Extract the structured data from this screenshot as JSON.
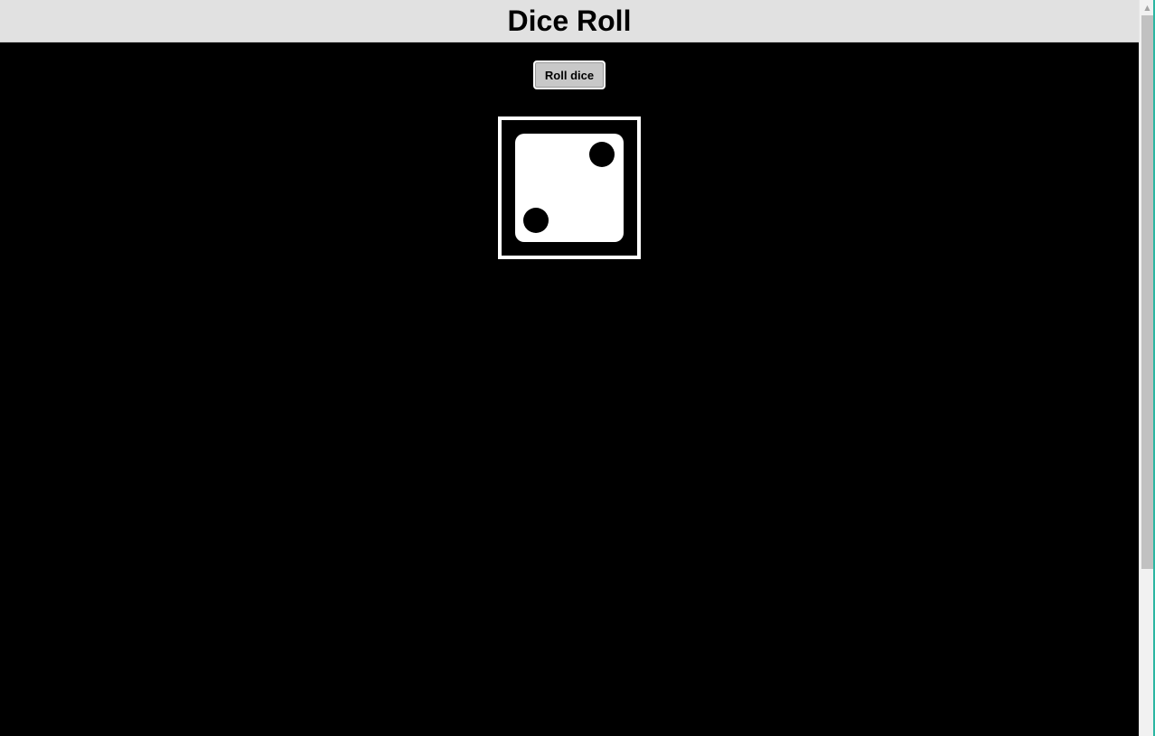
{
  "header": {
    "title": "Dice Roll"
  },
  "controls": {
    "roll_button_label": "Roll dice"
  },
  "die": {
    "value": 2,
    "pips": [
      "top-right",
      "bottom-left"
    ]
  },
  "colors": {
    "header_background": "#e1e1e1",
    "page_background": "#000000",
    "die_face": "#ffffff",
    "pip": "#000000",
    "button_background": "#c8c8c8"
  },
  "icons": {
    "die": "dice-two-icon",
    "scroll_up": "scroll-up-arrow-icon"
  }
}
